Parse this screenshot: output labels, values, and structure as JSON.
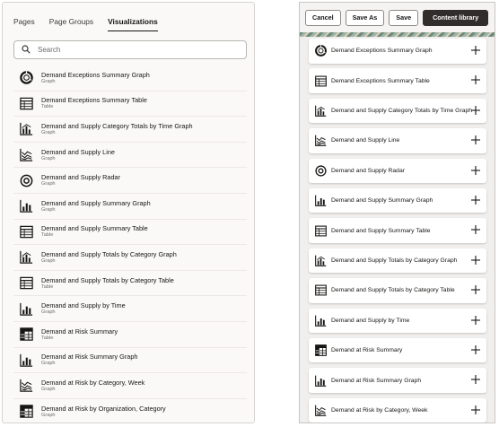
{
  "left": {
    "tabs": [
      {
        "label": "Pages",
        "active": false
      },
      {
        "label": "Page Groups",
        "active": false
      },
      {
        "label": "Visualizations",
        "active": true
      }
    ],
    "search": {
      "placeholder": "Search",
      "value": ""
    },
    "items": [
      {
        "title": "Demand Exceptions Summary Graph",
        "sub": "Graph",
        "icon": "ring-graph-icon"
      },
      {
        "title": "Demand Exceptions Summary Table",
        "sub": "Table",
        "icon": "table-icon"
      },
      {
        "title": "Demand and Supply Category Totals by Time Graph",
        "sub": "Graph",
        "icon": "bar-line-graph-icon"
      },
      {
        "title": "Demand and Supply Line",
        "sub": "Graph",
        "icon": "line-graph-icon"
      },
      {
        "title": "Demand and Supply Radar",
        "sub": "Graph",
        "icon": "radar-graph-icon"
      },
      {
        "title": "Demand and Supply Summary Graph",
        "sub": "Graph",
        "icon": "bar-graph-icon"
      },
      {
        "title": "Demand and Supply Summary Table",
        "sub": "Table",
        "icon": "table-icon"
      },
      {
        "title": "Demand and Supply Totals by Category Graph",
        "sub": "Graph",
        "icon": "bar-line-graph-icon"
      },
      {
        "title": "Demand and Supply Totals by Category Table",
        "sub": "Table",
        "icon": "table-icon"
      },
      {
        "title": "Demand and Supply by Time",
        "sub": "Graph",
        "icon": "bar-graph-icon"
      },
      {
        "title": "Demand at Risk Summary",
        "sub": "Table",
        "icon": "pivot-table-icon"
      },
      {
        "title": "Demand at Risk Summary Graph",
        "sub": "Graph",
        "icon": "bar-graph-icon"
      },
      {
        "title": "Demand at Risk by Category, Week",
        "sub": "Graph",
        "icon": "line-graph-icon"
      },
      {
        "title": "Demand at Risk by Organization, Category",
        "sub": "Graph",
        "icon": "pivot-table-icon"
      }
    ]
  },
  "right": {
    "toolbar": {
      "cancel": "Cancel",
      "save_as": "Save As",
      "save": "Save",
      "content_library": "Content library"
    },
    "cards": [
      {
        "title": "Demand Exceptions Summary Graph",
        "icon": "ring-graph-icon"
      },
      {
        "title": "Demand Exceptions Summary Table",
        "icon": "table-icon"
      },
      {
        "title": "Demand and Supply Category Totals by Time Graph",
        "icon": "bar-line-graph-icon"
      },
      {
        "title": "Demand and Supply Line",
        "icon": "line-graph-icon"
      },
      {
        "title": "Demand and Supply Radar",
        "icon": "radar-graph-icon"
      },
      {
        "title": "Demand and Supply Summary Graph",
        "icon": "bar-graph-icon"
      },
      {
        "title": "Demand and Supply Summary Table",
        "icon": "table-icon"
      },
      {
        "title": "Demand and Supply Totals by Category Graph",
        "icon": "bar-line-graph-icon"
      },
      {
        "title": "Demand and Supply Totals by Category Table",
        "icon": "table-icon"
      },
      {
        "title": "Demand and Supply by Time",
        "icon": "bar-graph-icon"
      },
      {
        "title": "Demand at Risk Summary",
        "icon": "pivot-table-icon"
      },
      {
        "title": "Demand at Risk Summary Graph",
        "icon": "bar-graph-icon"
      },
      {
        "title": "Demand at Risk by Category, Week",
        "icon": "line-graph-icon"
      }
    ]
  }
}
